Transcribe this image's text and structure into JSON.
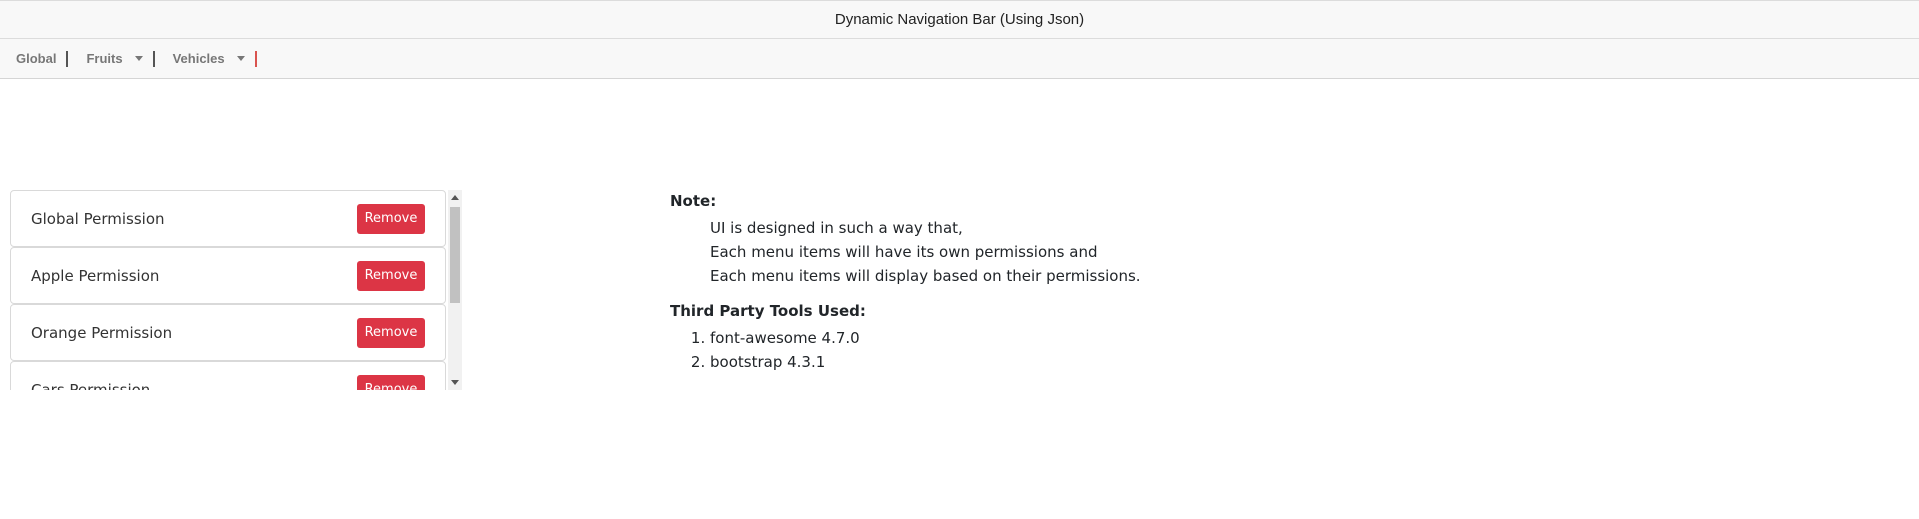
{
  "header": {
    "title": "Dynamic Navigation Bar (Using Json)"
  },
  "navbar": {
    "items": [
      {
        "label": "Global",
        "has_dropdown": false
      },
      {
        "label": "Fruits",
        "has_dropdown": true
      },
      {
        "label": "Vehicles",
        "has_dropdown": true
      }
    ]
  },
  "permissions": {
    "items": [
      {
        "label": "Global Permission",
        "button": "Remove"
      },
      {
        "label": "Apple Permission",
        "button": "Remove"
      },
      {
        "label": "Orange Permission",
        "button": "Remove"
      },
      {
        "label": "Cars Permission",
        "button": "Remove"
      }
    ]
  },
  "note": {
    "title": "Note:",
    "lines": [
      "UI is designed in such a way that,",
      "Each menu items will have its own permissions and",
      "Each menu items will display based on their permissions."
    ]
  },
  "tools": {
    "title": "Third Party Tools Used:",
    "items": [
      "font-awesome 4.7.0",
      "bootstrap 4.3.1"
    ]
  },
  "colors": {
    "danger": "#dc3545",
    "navbar_bg": "#f8f8f8",
    "last_separator": "#d9534f"
  }
}
